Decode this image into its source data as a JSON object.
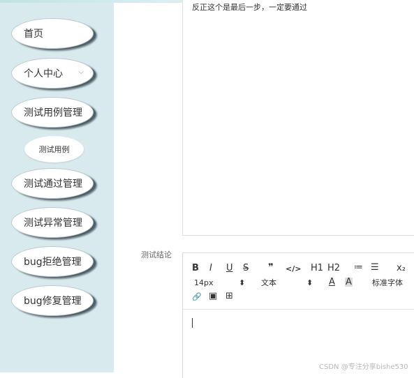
{
  "sidebar": {
    "items": [
      {
        "label": "首页"
      },
      {
        "label": "个人中心",
        "chevron": "⌵"
      },
      {
        "label": "测试用例管理"
      },
      {
        "label": "测试通过管理"
      },
      {
        "label": "测试异常管理"
      },
      {
        "label": "bug拒绝管理"
      },
      {
        "label": "bug修复管理"
      }
    ],
    "sub_item": "测试用例"
  },
  "content": {
    "text": "反正这个是最后一步，一定要通过"
  },
  "form": {
    "conclusion_label": "测试结论"
  },
  "editor": {
    "toolbar": {
      "bold": "B",
      "italic": "I",
      "underline": "U",
      "strike": "S",
      "quote": "❞",
      "code": "</>",
      "h1": "H1",
      "h2": "H2",
      "ordered_list": "≔",
      "bullet_list": "☰",
      "subscript": "x₂",
      "font_size": "14px",
      "paragraph": "文本",
      "select_arrow": "⬍",
      "font_color": "A",
      "bg_color": "A",
      "font_family": "标准字体",
      "link": "🔗",
      "image": "▣",
      "video": "⊞"
    }
  },
  "watermark": "CSDN @专注分享bishe530"
}
